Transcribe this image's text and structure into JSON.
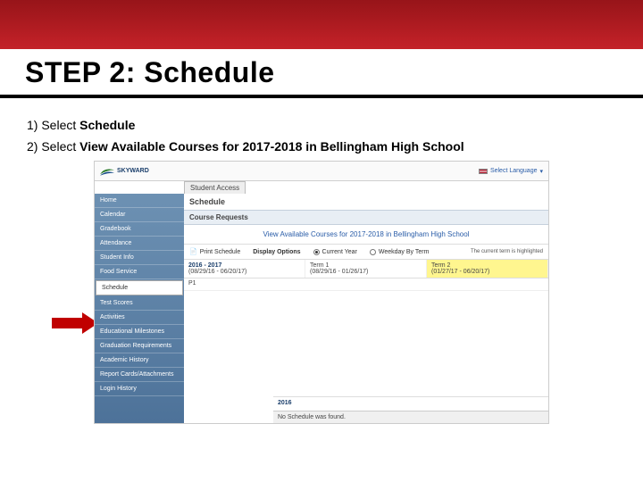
{
  "title": "STEP 2: Schedule",
  "instructions": {
    "item1_prefix": "1)  Select ",
    "item1_bold": "Schedule",
    "item2_prefix": "2)  Select ",
    "item2_bold": "View Available Courses for 2017-2018 in Bellingham High School"
  },
  "screenshot": {
    "logo_text": "SKYWARD",
    "tab": "Student Access",
    "top_link": "Select Language",
    "sidebar": {
      "items": [
        "Home",
        "Calendar",
        "Gradebook",
        "Attendance",
        "Student Info",
        "Food Service",
        "Schedule",
        "Test Scores",
        "Activities",
        "Educational Milestones",
        "Graduation Requirements",
        "Academic History",
        "Report Cards/Attachments",
        "Login History"
      ],
      "selected_index": 6
    },
    "main": {
      "header": "Schedule",
      "subheader": "Course Requests",
      "link_row": "View Available Courses for 2017-2018 in Bellingham High School",
      "options": {
        "print_label": "Print Schedule",
        "display_label": "Display Options",
        "opt1": "Current Year",
        "opt2": "Weekday By Term",
        "note": "The current term is highlighted"
      },
      "terms": {
        "year": "2016 - 2017",
        "year_range": "(08/29/16 - 06/20/17)",
        "t1_label": "Term 1",
        "t1_range": "(08/29/16 - 01/26/17)",
        "t2_label": "Term 2",
        "t2_range": "(01/27/17 - 06/20/17)"
      },
      "row_label": "P1",
      "wb_year": "2016",
      "footer": "No Schedule was found."
    }
  }
}
